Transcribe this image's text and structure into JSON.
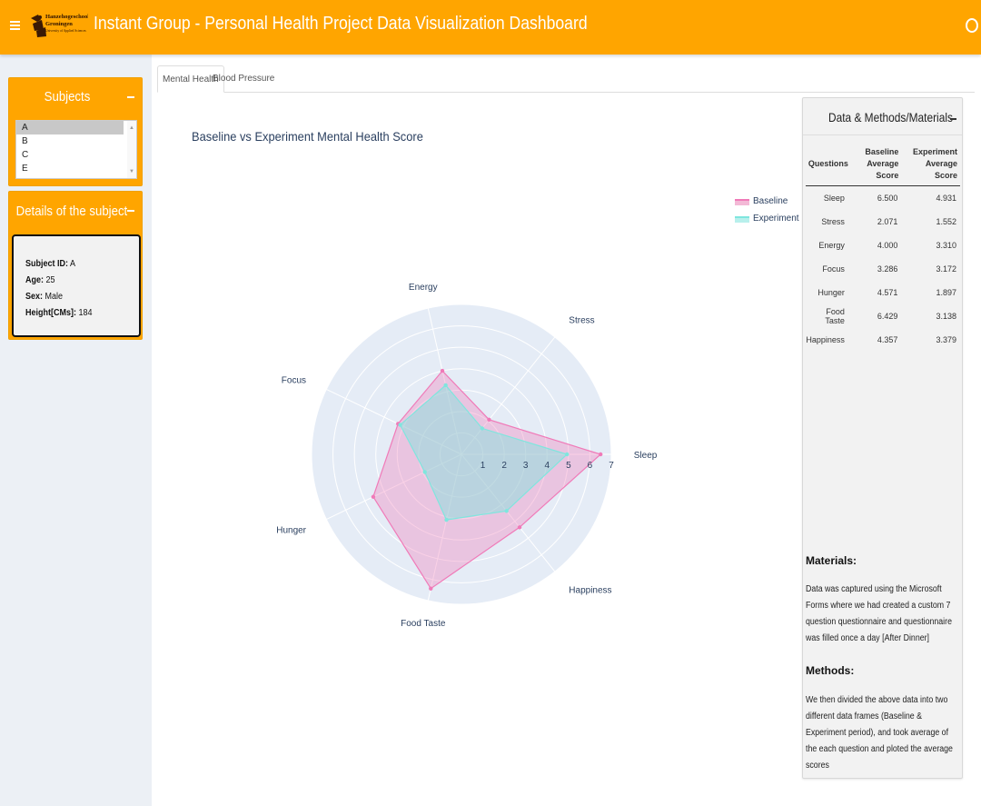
{
  "header": {
    "title": "Instant Group - Personal Health Project Data Visualization Dashboard",
    "logo_text": [
      "Hanzehogeschool",
      "Groningen",
      "University of Applied Sciences"
    ]
  },
  "sidebar": {
    "subjects": {
      "title": "Subjects",
      "options": [
        "A",
        "B",
        "C",
        "E"
      ],
      "selected": "A"
    },
    "details": {
      "title": "Details of the subject",
      "fields": [
        {
          "label": "Subject ID:",
          "value": "A"
        },
        {
          "label": "Age:",
          "value": "25"
        },
        {
          "label": "Sex:",
          "value": "Male"
        },
        {
          "label": "Height[CMs]:",
          "value": "184"
        }
      ]
    }
  },
  "tabs": [
    {
      "label": "Mental Health",
      "active": true
    },
    {
      "label": "Blood Pressure",
      "active": false
    }
  ],
  "chart_data": {
    "type": "radar",
    "title": "Baseline vs Experiment Mental Health Score",
    "axes": [
      "Sleep",
      "Stress",
      "Energy",
      "Focus",
      "Hunger",
      "Food Taste",
      "Happiness"
    ],
    "radial_range": [
      0,
      7
    ],
    "radial_ticks": [
      1,
      2,
      3,
      4,
      5,
      6,
      7
    ],
    "legend_position": "top-right",
    "series": [
      {
        "name": "Baseline",
        "color": "#f07ab8",
        "values": [
          6.5,
          2.071,
          4.0,
          3.286,
          4.571,
          6.429,
          4.357
        ]
      },
      {
        "name": "Experiment",
        "color": "#7fe6de",
        "values": [
          4.931,
          1.552,
          3.31,
          3.172,
          1.897,
          3.138,
          3.379
        ]
      }
    ]
  },
  "panel": {
    "title": "Data & Methods/Materials",
    "table": {
      "headers": [
        "Questions",
        "Baseline Average Score",
        "Experiment Average Score"
      ],
      "rows": [
        [
          "Sleep",
          "6.500",
          "4.931"
        ],
        [
          "Stress",
          "2.071",
          "1.552"
        ],
        [
          "Energy",
          "4.000",
          "3.310"
        ],
        [
          "Focus",
          "3.286",
          "3.172"
        ],
        [
          "Hunger",
          "4.571",
          "1.897"
        ],
        [
          "Food Taste",
          "6.429",
          "3.138"
        ],
        [
          "Happiness",
          "4.357",
          "3.379"
        ]
      ]
    },
    "materials_title": "Materials:",
    "materials_text": "Data was captured using the Microsoft Forms where we had created a custom 7 question questionnaire and questionnaire was filled once a day [After Dinner]",
    "methods_title": "Methods:",
    "methods_text": "We then divided the above data into two different data frames (Baseline & Experiment period), and took average of the each question and ploted the average scores"
  }
}
